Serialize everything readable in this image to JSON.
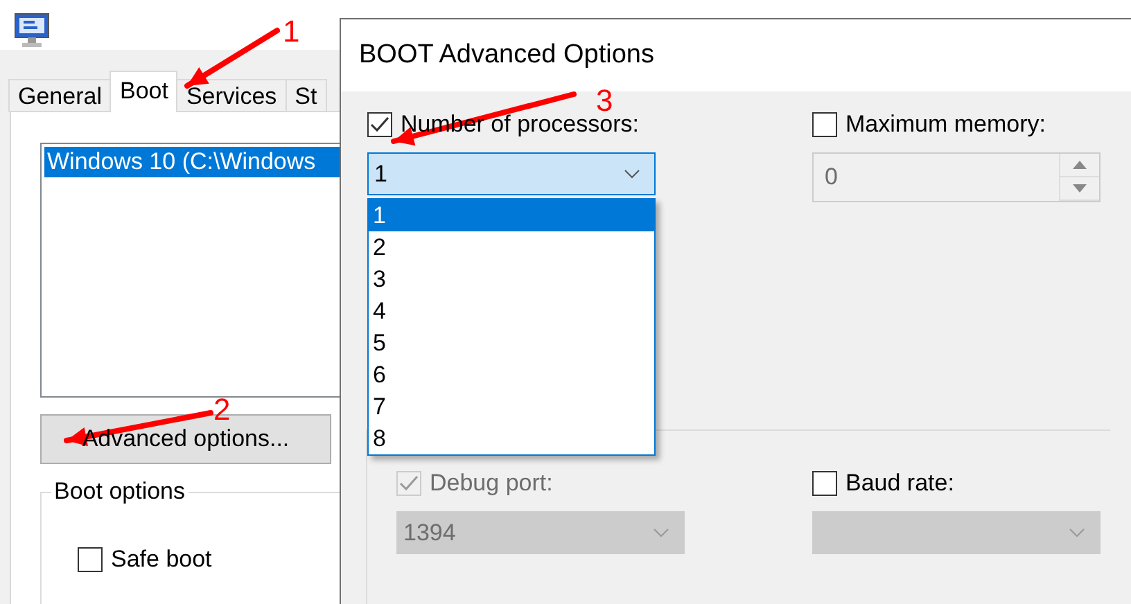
{
  "back_window": {
    "tabs": [
      {
        "label": "General",
        "selected": false
      },
      {
        "label": "Boot",
        "selected": true
      },
      {
        "label": "Services",
        "selected": false
      },
      {
        "label": "St",
        "selected": false
      }
    ],
    "boot_list": [
      {
        "label": "Windows 10 (C:\\Windows",
        "selected": true
      }
    ],
    "advanced_button": "Advanced options...",
    "boot_options": {
      "title": "Boot options",
      "safe_boot": {
        "label": "Safe boot",
        "checked": false
      }
    }
  },
  "dialog": {
    "title": "BOOT Advanced Options",
    "processors": {
      "label": "Number of processors:",
      "checked": true,
      "value": "1",
      "expanded": true,
      "options": [
        {
          "label": "1",
          "selected": true
        },
        {
          "label": "2",
          "selected": false
        },
        {
          "label": "3",
          "selected": false
        },
        {
          "label": "4",
          "selected": false
        },
        {
          "label": "5",
          "selected": false
        },
        {
          "label": "6",
          "selected": false
        },
        {
          "label": "7",
          "selected": false
        },
        {
          "label": "8",
          "selected": false
        }
      ]
    },
    "max_memory": {
      "label": "Maximum memory:",
      "checked": false,
      "value": "0"
    },
    "debug_port": {
      "label": "Debug port:",
      "checked": true,
      "disabled": true,
      "value": "1394"
    },
    "baud_rate": {
      "label": "Baud rate:",
      "checked": false,
      "disabled": false
    }
  },
  "annotations": [
    "1",
    "2",
    "3"
  ]
}
